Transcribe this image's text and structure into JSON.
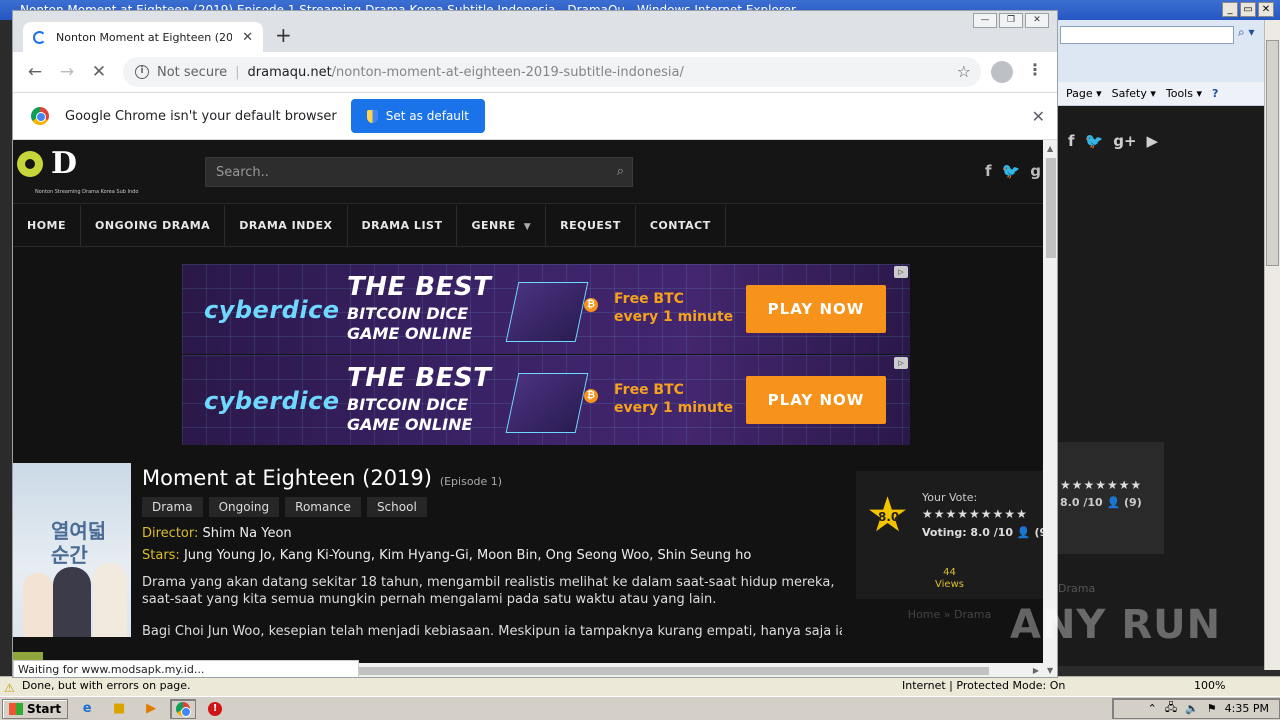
{
  "ie": {
    "title": "Nonton Moment at Eighteen (2019) Episode 1 Streaming Drama Korea Subtitle Indonesia - DramaQu - Windows Internet Explorer",
    "command_bar": [
      "Page ▾",
      "Safety ▾",
      "Tools ▾"
    ],
    "status_text": "Done, but with errors on page.",
    "zone_text": "Internet | Protected Mode: On",
    "zoom_text": "100%",
    "ghost_voting": "8.0 /10",
    "ghost_votes": "(9)",
    "ghost_crumb": "Drama"
  },
  "taskbar": {
    "start_label": "Start",
    "clock": "4:35 PM"
  },
  "chrome": {
    "tab_title": "Nonton Moment at Eighteen (2019) E",
    "omnibox": {
      "security": "Not secure",
      "host": "dramaqu.net",
      "path": "/nonton-moment-at-eighteen-2019-subtitle-indonesia/"
    },
    "infobar": {
      "message": "Google Chrome isn't your default browser",
      "button": "Set as default"
    },
    "status_bubble": "Waiting for www.modsapk.my.id..."
  },
  "site": {
    "logo_tag": "Nonton Streaming Drama Korea Sub Indo",
    "search_placeholder": "Search..",
    "nav": [
      "HOME",
      "ONGOING DRAMA",
      "DRAMA INDEX",
      "DRAMA LIST",
      "GENRE",
      "REQUEST",
      "CONTACT"
    ],
    "ads": [
      {
        "brand": "cyberdice",
        "line1": "THE BEST",
        "line2": "BITCOIN DICE",
        "line3": "GAME ONLINE",
        "free1": "Free BTC",
        "free2": "every 1 minute",
        "cta": "PLAY NOW"
      },
      {
        "brand": "cyberdice",
        "line1": "THE BEST",
        "line2": "BITCOIN DICE",
        "line3": "GAME ONLINE",
        "free1": "Free BTC",
        "free2": "every 1 minute",
        "cta": "PLAY NOW"
      }
    ],
    "drama": {
      "title": "Moment at Eighteen (2019)",
      "episode": "(Episode 1)",
      "genres": [
        "Drama",
        "Ongoing",
        "Romance",
        "School"
      ],
      "director_label": "Director:",
      "director": "Shim Na Yeon",
      "stars_label": "Stars:",
      "stars": "Jung Young Jo, Kang Ki-Young, Kim Hyang-Gi, Moon Bin, Ong Seong Woo, Shin Seung ho",
      "synopsis1": "Drama yang akan datang sekitar 18 tahun, mengambil realistis melihat ke dalam saat-saat hidup mereka, saat-saat yang kita semua mungkin pernah mengalami pada satu waktu atau yang lain.",
      "synopsis2": "Bagi Choi Jun Woo, kesepian telah menjadi kebiasaan. Meskipun ia tampaknya kurang empati, hanya saja ia"
    },
    "rating": {
      "score": "8.0",
      "your_vote": "Your Vote:",
      "voting": "Voting: 8.0 /10",
      "votes": "(9)",
      "views_count": "44",
      "views_label": "Views"
    },
    "breadcrumb": "Home » Drama"
  },
  "watermark": "ANY RUN"
}
